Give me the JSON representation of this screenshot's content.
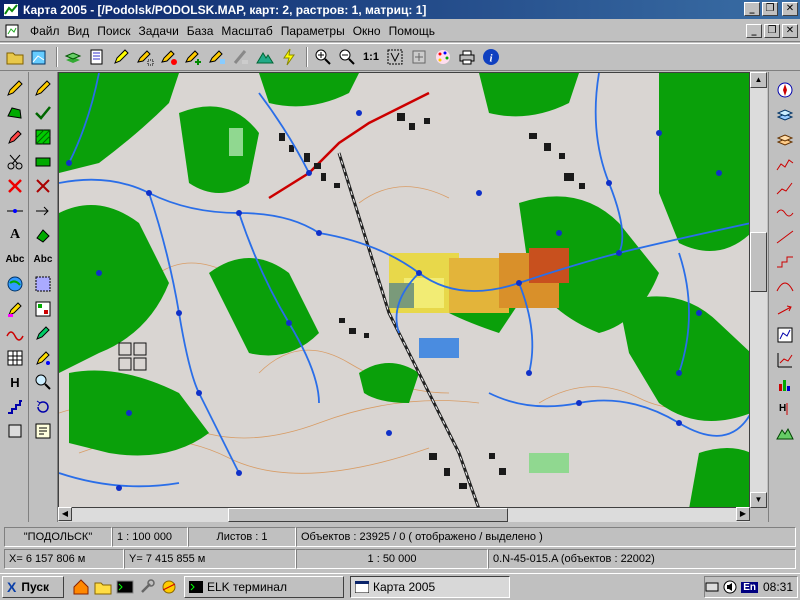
{
  "window": {
    "title": "Карта 2005 - [/Podolsk/PODOLSK.MAP, карт: 2, растров: 1, матриц: 1]"
  },
  "menu": {
    "items": [
      "Файл",
      "Вид",
      "Поиск",
      "Задачи",
      "База",
      "Масштаб",
      "Параметры",
      "Окно",
      "Помощь"
    ]
  },
  "toolbar": {
    "scale_1to1_label": "1:1"
  },
  "left_tools": {
    "text_tool_a": "A",
    "text_tool_abc": "Abc",
    "h_tool": "H"
  },
  "status": {
    "map_name": "\"ПОДОЛЬСК\"",
    "scale": "1 : 100 000",
    "sheets": "Листов : 1",
    "objects": "Объектов : 23925 / 0  ( отображено / выделено )",
    "x_coord": "X=   6 157 806 м",
    "y_coord": "Y=   7 415 855 м",
    "cur_scale": "1 : 50 000",
    "sheet_code": "0.N-45-015.A  (объектов : 22002)"
  },
  "taskbar": {
    "start_label": "Пуск",
    "tasks": [
      "ELK терминал",
      "Карта 2005"
    ],
    "language": "En",
    "clock": "08:31"
  }
}
